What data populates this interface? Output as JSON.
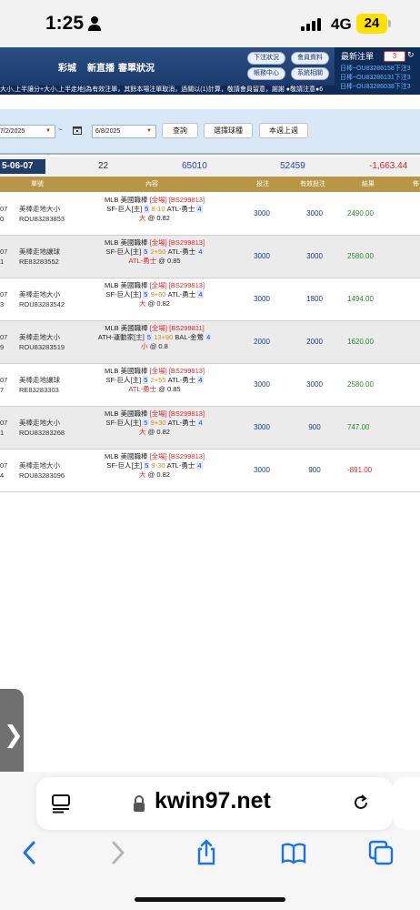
{
  "status_bar": {
    "time": "1:25",
    "network": "4G",
    "battery": "24"
  },
  "header": {
    "nav": [
      "彩城",
      "新直播",
      "審單狀況"
    ],
    "buttons": [
      "下注狀況",
      "會員資料",
      "帳務中心",
      "系統相關"
    ],
    "latest_title": "最新注單",
    "latest_count": "3",
    "latest_lines": [
      "日棒~OU83286158下注3",
      "日棒~OU83286131下注3",
      "日棒~OU83286038下注3"
    ]
  },
  "marquee": "大小,上半讓分+大小,上半走地)為有效注單，其餘本場注單取消，過關以(1)計算，敬請會員留意，謝謝 ●敬請注意●6",
  "filters": {
    "start_date": "7/2/2025",
    "tilde": "~",
    "end_date": "6/8/2025",
    "query_button": "查詢",
    "select_sport_button": "選擇球種",
    "this_last_week_button": "本週上週"
  },
  "summary": {
    "date": "5-06-07",
    "count": "22",
    "bet_total": "65010",
    "valid_total": "52459",
    "result_total": "-1,663.44"
  },
  "table_headers": {
    "no": "單號",
    "content": "內容",
    "bet": "投注",
    "valid": "有效投注",
    "result": "結果",
    "extra": "佈"
  },
  "rows": [
    {
      "num1": "07",
      "num2": "0",
      "type": "美棒走地大小",
      "ticket": "ROU83283853",
      "league": "MLB 美國職棒",
      "market": "[全場]",
      "code": "[BS299813]",
      "home": "SF-巨人[主]",
      "hn": "5",
      "score": "8-10",
      "away": "ATL-勇士",
      "an": "4",
      "pick": "大",
      "odds": "@ 0.82",
      "pick_color": "red",
      "bet": "3000",
      "valid": "3000",
      "result": "2490.00",
      "result_color": "green"
    },
    {
      "num1": "07",
      "num2": "1",
      "type": "美棒走地讓球",
      "ticket": "RE83283552",
      "league": "MLB 美國職棒",
      "market": "[全場]",
      "code": "[BS299813]",
      "home": "SF-巨人[主]",
      "hn": "5",
      "score": "2+50",
      "away": "ATL-勇士",
      "an": "4",
      "pick": "ATL-勇士",
      "odds": "@ 0.85",
      "pick_color": "red",
      "bet": "3000",
      "valid": "3000",
      "result": "2580.00",
      "result_color": "green"
    },
    {
      "num1": "07",
      "num2": "3",
      "type": "美棒走地大小",
      "ticket": "ROU83283542",
      "league": "MLB 美國職棒",
      "market": "[全場]",
      "code": "[BS299813]",
      "home": "SF-巨人[主]",
      "hn": "5",
      "score": "9+60",
      "away": "ATL-勇士",
      "an": "4",
      "pick": "大",
      "odds": "@ 0.82",
      "pick_color": "red",
      "bet": "3000",
      "valid": "1800",
      "result": "1494.00",
      "result_color": "green"
    },
    {
      "num1": "07",
      "num2": "9",
      "type": "美棒走地大小",
      "ticket": "ROU83283519",
      "league": "MLB 美國職棒",
      "market": "[全場]",
      "code": "[BS299811]",
      "home": "ATH-運動家[主]",
      "hn": "5",
      "score": "13+90",
      "away": "BAL-金鶯",
      "an": "4",
      "pick": "小",
      "odds": "@ 0.8",
      "pick_color": "red",
      "bet": "2000",
      "valid": "2000",
      "result": "1620.00",
      "result_color": "green"
    },
    {
      "num1": "07",
      "num2": "7",
      "type": "美棒走地讓球",
      "ticket": "RE83283303",
      "league": "MLB 美國職棒",
      "market": "[全場]",
      "code": "[BS299813]",
      "home": "SF-巨人[主]",
      "hn": "5",
      "score": "2+55",
      "away": "ATL-勇士",
      "an": "4",
      "pick": "ATL-勇士",
      "odds": "@ 0.85",
      "pick_color": "red",
      "bet": "3000",
      "valid": "3000",
      "result": "2580.00",
      "result_color": "green"
    },
    {
      "num1": "07",
      "num2": "1",
      "type": "美棒走地大小",
      "ticket": "ROU83283268",
      "league": "MLB 美國職棒",
      "market": "[全場]",
      "code": "[BS299813]",
      "home": "SF-巨人[主]",
      "hn": "5",
      "score": "9+30",
      "away": "ATL-勇士",
      "an": "4",
      "pick": "大",
      "odds": "@ 0.82",
      "pick_color": "red",
      "bet": "3000",
      "valid": "900",
      "result": "747.00",
      "result_color": "green"
    },
    {
      "num1": "07",
      "num2": "4",
      "type": "美棒走地大小",
      "ticket": "ROU83283096",
      "league": "MLB 美國職棒",
      "market": "[全場]",
      "code": "[BS299813]",
      "home": "SF-巨人[主]",
      "hn": "5",
      "score": "9-30",
      "away": "ATL-勇士",
      "an": "4",
      "pick": "大",
      "odds": "@ 0.82",
      "pick_color": "red",
      "bet": "3000",
      "valid": "900",
      "result": "-891.00",
      "result_color": "red"
    }
  ],
  "browser": {
    "url": "kwin97.net"
  },
  "colors": {
    "header_blue": "#1c3a6a",
    "table_head_gold": "#b79746",
    "win_green": "#2c8a2c",
    "loss_red": "#e0262a"
  }
}
